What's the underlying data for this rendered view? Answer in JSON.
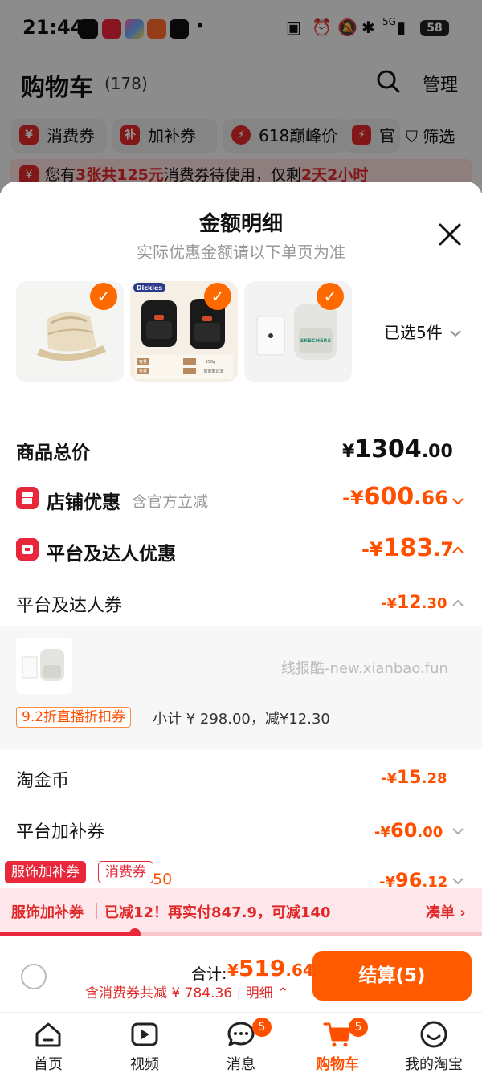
{
  "status_bar": {
    "time": "21:44",
    "network": "5G",
    "battery": "58"
  },
  "background": {
    "title": "购物车",
    "count": "(178)",
    "manage": "管理",
    "tabs": [
      {
        "badge": "¥",
        "label": "消费券"
      },
      {
        "badge": "补",
        "label": "加补券"
      },
      {
        "badge": "⚡",
        "label": "618巅峰价"
      },
      {
        "badge": "⚡",
        "label": "官"
      }
    ],
    "filter": "筛选",
    "notice": {
      "badge": "¥",
      "p1": "您有",
      "p2": "3张共125元",
      "p3": "消费券待使用，仅剩",
      "p4": "2天2小时"
    }
  },
  "sheet": {
    "title": "金额明细",
    "subtitle": "实际优惠金额请以下单页为准",
    "selected": "已选5件",
    "products": [
      {
        "name": "straw-hat"
      },
      {
        "name": "dickies-backpack",
        "brand": "Dickies",
        "spec_labels": [
          "容量",
          "重量",
          "550g",
          "放置笔记本"
        ]
      },
      {
        "name": "skechers-backpack",
        "brand": "SKECHERS"
      }
    ],
    "rows": {
      "total": {
        "label": "商品总价",
        "symbol": "¥",
        "int": "1304",
        "dec": ".00"
      },
      "store": {
        "label": "店铺优惠",
        "note": "含官方立减",
        "prefix": "-¥",
        "int": "600",
        "dec": ".66"
      },
      "platform": {
        "label": "平台及达人优惠",
        "prefix": "-¥",
        "int": "183",
        "dec": ".7"
      },
      "platform_coupon": {
        "label": "平台及达人券",
        "prefix": "-¥",
        "int": "12",
        "dec": ".30"
      },
      "gold": {
        "label": "淘金币",
        "prefix": "-¥",
        "int": "15",
        "dec": ".28"
      },
      "bonus": {
        "label": "平台加补券",
        "prefix": "-¥",
        "int": "60",
        "dec": ".00"
      },
      "last": {
        "partial": "50",
        "prefix": "-¥",
        "int": "96",
        "dec": ".12"
      }
    },
    "sub_item": {
      "watermark": "线报酷-new.xianbao.fun",
      "coupon_tag": "9.2折直播折扣券",
      "subtotal": "小计 ¥ 298.00，减¥12.30"
    }
  },
  "promo": {
    "tag1": "服饰加补券",
    "tag2": "消费券",
    "label": "服饰加补券",
    "text": "已减12！再实付847.9，可减140",
    "action": "凑单",
    "progress": 0.28
  },
  "checkout": {
    "total_label": "合计:",
    "total_symbol": "¥",
    "total_int": "519",
    "total_dec": ".64",
    "discount": "含消费券共减 ¥ 784.36",
    "detail": "明细",
    "button": "结算(5)"
  },
  "tabbar": [
    {
      "label": "首页",
      "icon": "home-icon"
    },
    {
      "label": "视频",
      "icon": "video-icon"
    },
    {
      "label": "消息",
      "icon": "message-icon",
      "badge": "5"
    },
    {
      "label": "购物车",
      "icon": "cart-icon",
      "badge": "5",
      "active": true
    },
    {
      "label": "我的淘宝",
      "icon": "profile-icon"
    }
  ],
  "colors": {
    "accent": "#ff5000",
    "red": "#e8273a",
    "button": "#ff5a00"
  }
}
